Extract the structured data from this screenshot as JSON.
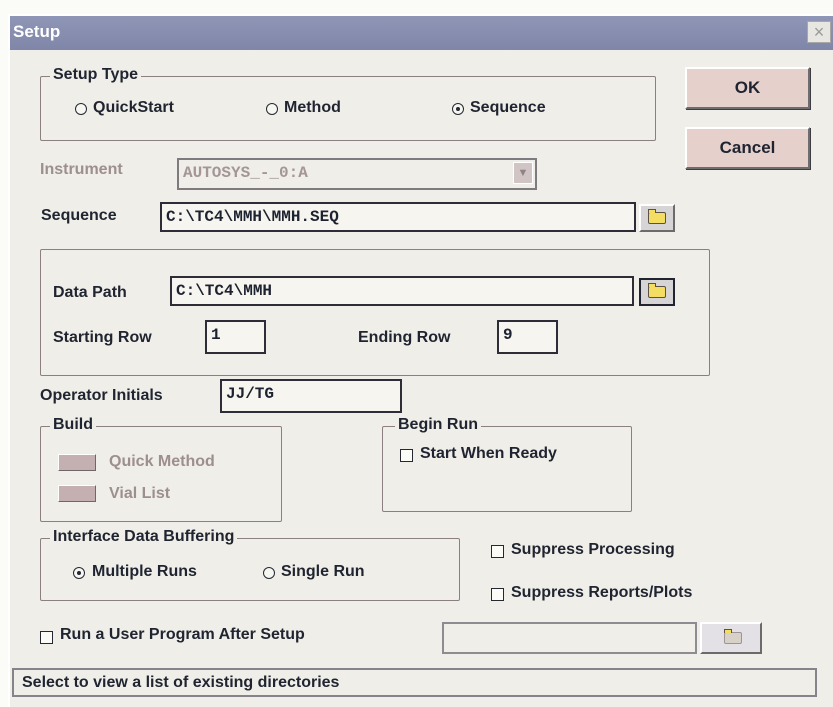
{
  "window": {
    "title": "Setup"
  },
  "buttons": {
    "ok": "OK",
    "cancel": "Cancel"
  },
  "setup_type": {
    "label": "Setup Type",
    "options": [
      {
        "label": "QuickStart",
        "selected": false
      },
      {
        "label": "Method",
        "selected": false
      },
      {
        "label": "Sequence",
        "selected": true
      }
    ]
  },
  "instrument": {
    "label": "Instrument",
    "value": "AUTOSYS_-_0:A",
    "dropdown_arrow": "▼"
  },
  "sequence": {
    "label": "Sequence",
    "value": "C:\\TC4\\MMH\\MMH.SEQ"
  },
  "data_path": {
    "label": "Data Path",
    "value": "C:\\TC4\\MMH"
  },
  "rows": {
    "starting_label": "Starting Row",
    "starting_value": "1",
    "ending_label": "Ending Row",
    "ending_value": "9"
  },
  "operator": {
    "label": "Operator Initials",
    "value": "JJ/TG"
  },
  "build": {
    "label": "Build",
    "items": [
      {
        "label": "Quick Method"
      },
      {
        "label": "Vial List"
      }
    ]
  },
  "begin_run": {
    "label": "Begin Run",
    "checkbox": {
      "label": "Start When Ready",
      "checked": false
    }
  },
  "buffering": {
    "label": "Interface Data Buffering",
    "options": [
      {
        "label": "Multiple Runs",
        "selected": true
      },
      {
        "label": "Single Run",
        "selected": false
      }
    ]
  },
  "suppress": {
    "processing": "Suppress Processing",
    "reports": "Suppress Reports/Plots"
  },
  "user_program": {
    "label": "Run a User Program After Setup",
    "checked": false,
    "value": ""
  },
  "status": {
    "text": "Select to view a list of existing directories"
  },
  "icons": {
    "folder": "folder-icon",
    "close": "close-icon",
    "dropdown": "chevron-down-icon"
  },
  "colors": {
    "title_bar": "#8f96b6",
    "dialog_bg": "#efeee8",
    "button_face": "#e5d0cb",
    "text": "#1f2430",
    "disabled_text": "#9e8f8f"
  }
}
